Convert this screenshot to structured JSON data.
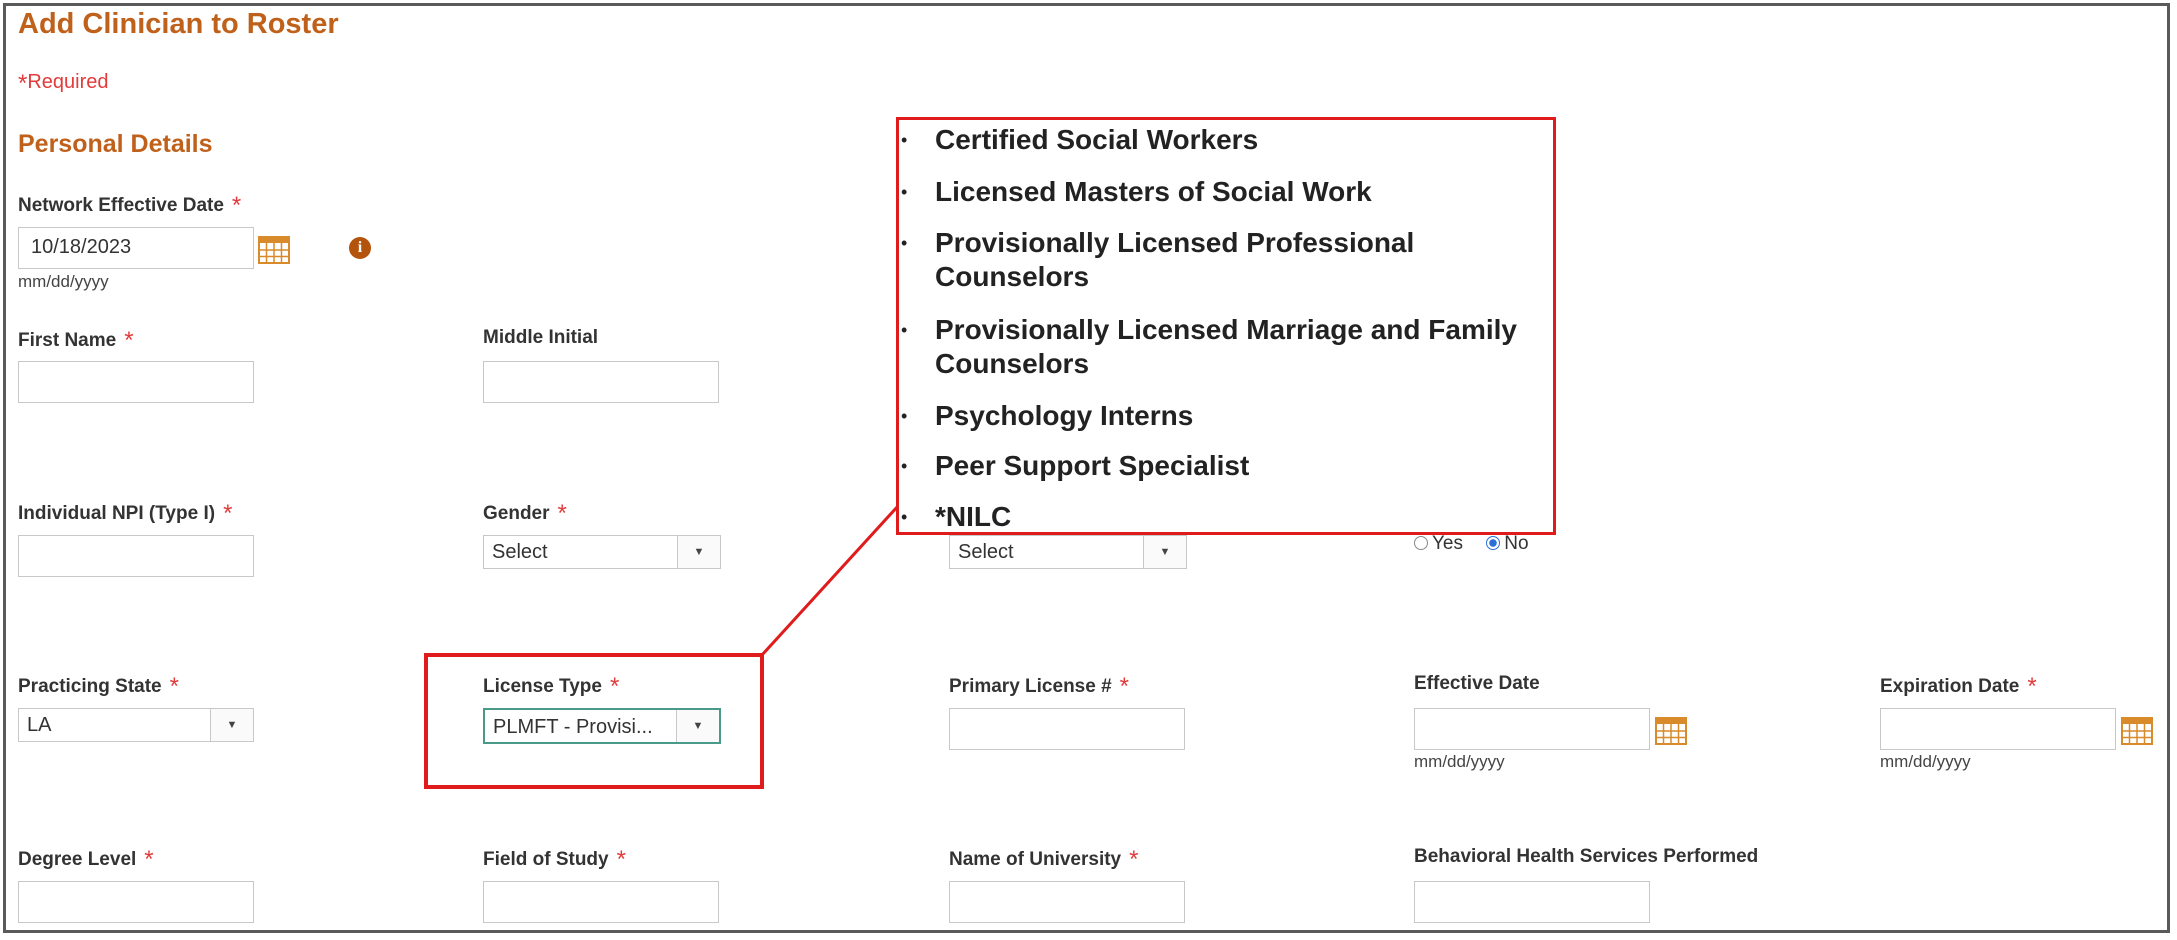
{
  "page": {
    "title": "Add Clinician to Roster",
    "required_star": "*",
    "required_label": "Required",
    "section_title": "Personal Details"
  },
  "star": "*",
  "fields": {
    "network_effective_date": {
      "label": "Network Effective Date",
      "value": "10/18/2023",
      "hint": "mm/dd/yyyy"
    },
    "first_name": {
      "label": "First Name"
    },
    "middle_initial": {
      "label": "Middle Initial"
    },
    "individual_npi": {
      "label": "Individual NPI (Type I)"
    },
    "gender": {
      "label": "Gender",
      "value": "Select"
    },
    "third_select": {
      "value": "Select"
    },
    "yes_no": {
      "yes": "Yes",
      "no": "No",
      "selected": "No"
    },
    "practicing_state": {
      "label": "Practicing State",
      "value": "LA"
    },
    "license_type": {
      "label": "License Type",
      "value": "PLMFT - Provisi..."
    },
    "primary_license": {
      "label": "Primary License #"
    },
    "effective_date": {
      "label": "Effective Date",
      "hint": "mm/dd/yyyy"
    },
    "expiration_date": {
      "label": "Expiration Date",
      "hint": "mm/dd/yyyy"
    },
    "degree_level": {
      "label": "Degree Level"
    },
    "field_of_study": {
      "label": "Field of Study"
    },
    "name_of_university": {
      "label": "Name of University"
    },
    "behavioral_health": {
      "label": "Behavioral Health Services Performed"
    }
  },
  "callout": {
    "items": [
      "Certified Social Workers",
      "Licensed Masters of Social Work",
      "Provisionally Licensed Professional Counselors",
      "Provisionally Licensed Marriage and Family Counselors",
      "Psychology Interns",
      "Peer Support Specialist",
      "*NILC"
    ]
  },
  "colors": {
    "heading": "#c0611b",
    "required_star": "#e23b3b",
    "callout_border": "#e01b1b",
    "focus_border": "#4a9a8a"
  },
  "icons": {
    "calendar": "calendar-icon",
    "info": "info-icon",
    "dropdown": "chevron-down-icon"
  }
}
